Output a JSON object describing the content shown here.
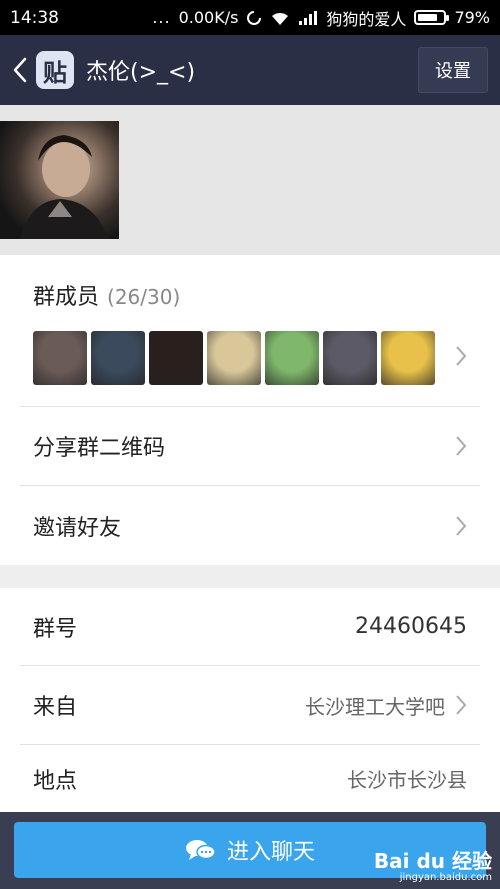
{
  "status_bar": {
    "time": "14:38",
    "dots": "...",
    "speed": "0.00K/s",
    "carrier": "狗狗的爱人",
    "battery": "79%",
    "battery_level": 0.79
  },
  "header": {
    "logo_char": "贴",
    "title": "杰伦(>_<)",
    "settings_label": "设置"
  },
  "members_section": {
    "label": "群成员",
    "count": "(26/30)",
    "avatars": [
      {
        "name": "member-avatar-1",
        "color": "#6b5b57"
      },
      {
        "name": "member-avatar-2",
        "color": "#3b4a5c"
      },
      {
        "name": "member-avatar-3",
        "color": "#2a1f1c"
      },
      {
        "name": "member-avatar-4",
        "color": "#d9c79a"
      },
      {
        "name": "member-avatar-5",
        "color": "#7fb86c"
      },
      {
        "name": "member-avatar-6",
        "color": "#5c5a66"
      },
      {
        "name": "member-avatar-7",
        "color": "#e7c14a"
      }
    ]
  },
  "menu": {
    "share_qr": "分享群二维码",
    "invite": "邀请好友"
  },
  "info": {
    "group_id_label": "群号",
    "group_id_value": "24460645",
    "from_label": "来自",
    "from_value": "长沙理工大学吧",
    "location_label": "地点",
    "location_value": "长沙市长沙县"
  },
  "footer": {
    "enter_chat": "进入聊天",
    "watermark_main": "Bai du 经验",
    "watermark_sub": "jingyan.baidu.com"
  },
  "colors": {
    "header_bg": "#2b2f45",
    "accent": "#3aa4ec"
  }
}
